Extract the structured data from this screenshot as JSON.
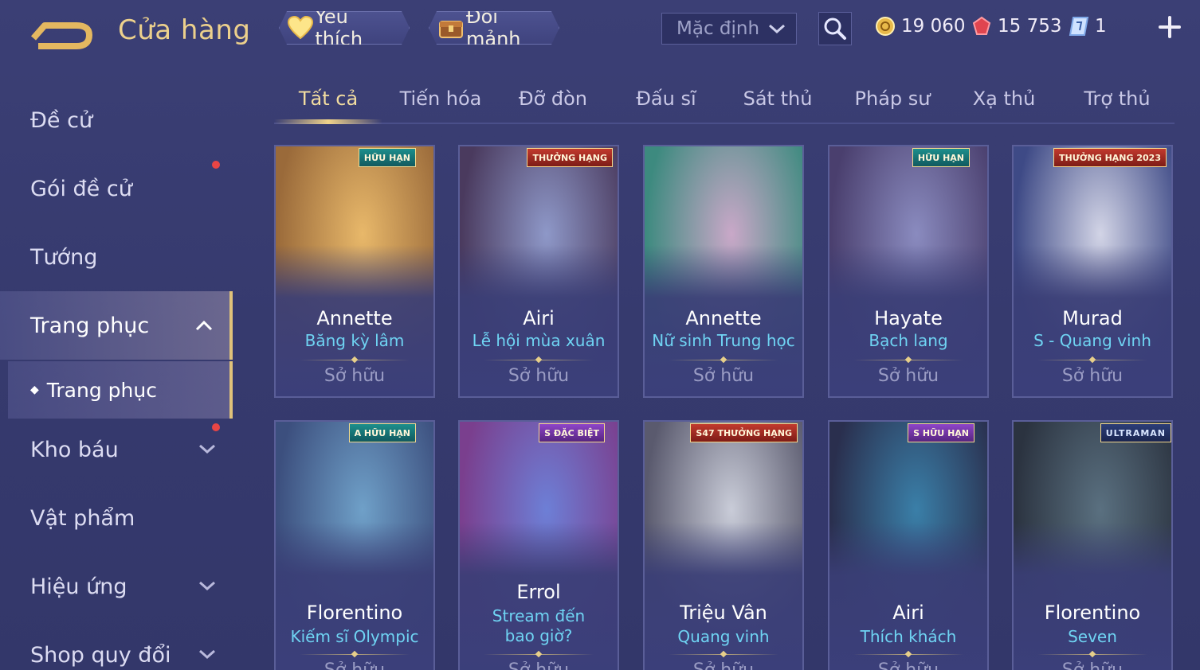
{
  "header": {
    "title": "Cửa hàng",
    "favorite_label": "Yêu thích",
    "shard_label": "Đổi mảnh",
    "sort_selected": "Mặc định",
    "currencies": [
      {
        "icon": "gold-coin-icon",
        "value": "19 060"
      },
      {
        "icon": "voucher-gem-icon",
        "value": "15 753"
      },
      {
        "icon": "ticket-icon",
        "value": "1"
      }
    ]
  },
  "sidebar": {
    "items": [
      {
        "label": "Đề cử"
      },
      {
        "label": "Gói đề cử"
      },
      {
        "label": "Tướng"
      },
      {
        "label": "Trang phục"
      },
      {
        "label": "Trang phục"
      },
      {
        "label": "Kho báu"
      },
      {
        "label": "Vật phẩm"
      },
      {
        "label": "Hiệu ứng"
      },
      {
        "label": "Shop quy đổi"
      }
    ]
  },
  "tabs": [
    {
      "label": "Tất cả"
    },
    {
      "label": "Tiến hóa"
    },
    {
      "label": "Đỡ đòn"
    },
    {
      "label": "Đấu sĩ"
    },
    {
      "label": "Sát thủ"
    },
    {
      "label": "Pháp sư"
    },
    {
      "label": "Xạ thủ"
    },
    {
      "label": "Trợ thủ"
    }
  ],
  "cards": [
    {
      "hero": "Annette",
      "skin": "Băng kỳ lâm",
      "status": "Sở hữu",
      "badge": "HỮU HẠN",
      "badge_style": "teal",
      "art_a": "#e8b86a",
      "art_b": "#9a6a3a"
    },
    {
      "hero": "Airi",
      "skin": "Lễ hội mùa xuân",
      "status": "Sở hữu",
      "badge": "THƯỞNG HẠNG",
      "badge_style": "red",
      "art_a": "#8e98c8",
      "art_b": "#4a3a5e"
    },
    {
      "hero": "Annette",
      "skin": "Nữ sinh Trung học",
      "status": "Sở hữu",
      "badge": "",
      "badge_style": "",
      "art_a": "#c9a8c8",
      "art_b": "#3d8a7f"
    },
    {
      "hero": "Hayate",
      "skin": "Bạch lang",
      "status": "Sở hữu",
      "badge": "HỮU HẠN",
      "badge_style": "teal",
      "art_a": "#8a8bbf",
      "art_b": "#4a3f6e"
    },
    {
      "hero": "Murad",
      "skin": "S - Quang vinh",
      "status": "Sở hữu",
      "badge": "THƯỞNG HẠNG 2023",
      "badge_style": "red",
      "art_a": "#d2d4e6",
      "art_b": "#3e4a86"
    },
    {
      "hero": "Florentino",
      "skin": "Kiếm sĩ Olympic",
      "status": "Sở hữu",
      "badge": "A HỮU HẠN",
      "badge_style": "teal",
      "art_a": "#6fa0c8",
      "art_b": "#3c4f7e"
    },
    {
      "hero": "Errol",
      "skin": "Stream đến bao giờ?",
      "status": "Sở hữu",
      "badge": "S ĐẶC BIỆT",
      "badge_style": "purple",
      "art_a": "#6d7fd6",
      "art_b": "#7a3f8e"
    },
    {
      "hero": "Triệu Vân",
      "skin": "Quang vinh",
      "status": "Sở hữu",
      "badge": "S47 THƯỞNG HẠNG",
      "badge_style": "red",
      "art_a": "#c9ccd8",
      "art_b": "#5a5a6e"
    },
    {
      "hero": "Airi",
      "skin": "Thích khách",
      "status": "Sở hữu",
      "badge": "S HỮU HẠN",
      "badge_style": "purple",
      "art_a": "#3a7fa8",
      "art_b": "#2a2f4e"
    },
    {
      "hero": "Florentino",
      "skin": "Seven",
      "status": "Sở hữu",
      "badge": "ULTRAMAN",
      "badge_style": "blue",
      "art_a": "#5a7080",
      "art_b": "#2b3340"
    }
  ]
}
